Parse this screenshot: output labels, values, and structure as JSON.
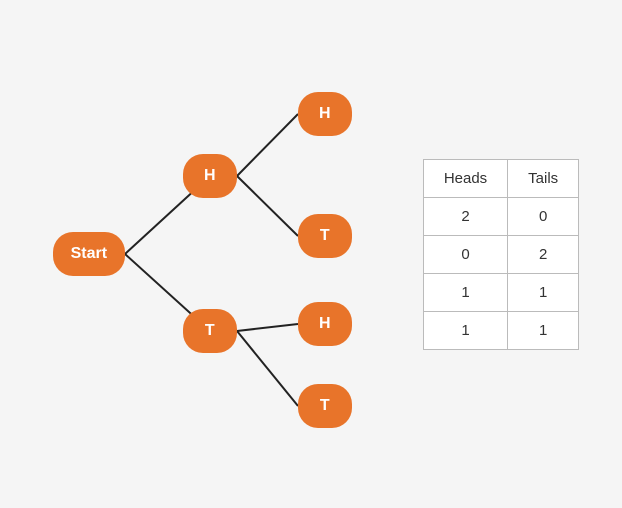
{
  "tree": {
    "nodes": {
      "start": "Start",
      "h1": "H",
      "t1": "T",
      "hh": "H",
      "ht": "T",
      "th": "H",
      "tt": "T"
    }
  },
  "table": {
    "headers": [
      "Heads",
      "Tails"
    ],
    "rows": [
      [
        "2",
        "0"
      ],
      [
        "0",
        "2"
      ],
      [
        "1",
        "1"
      ],
      [
        "1",
        "1"
      ]
    ]
  }
}
